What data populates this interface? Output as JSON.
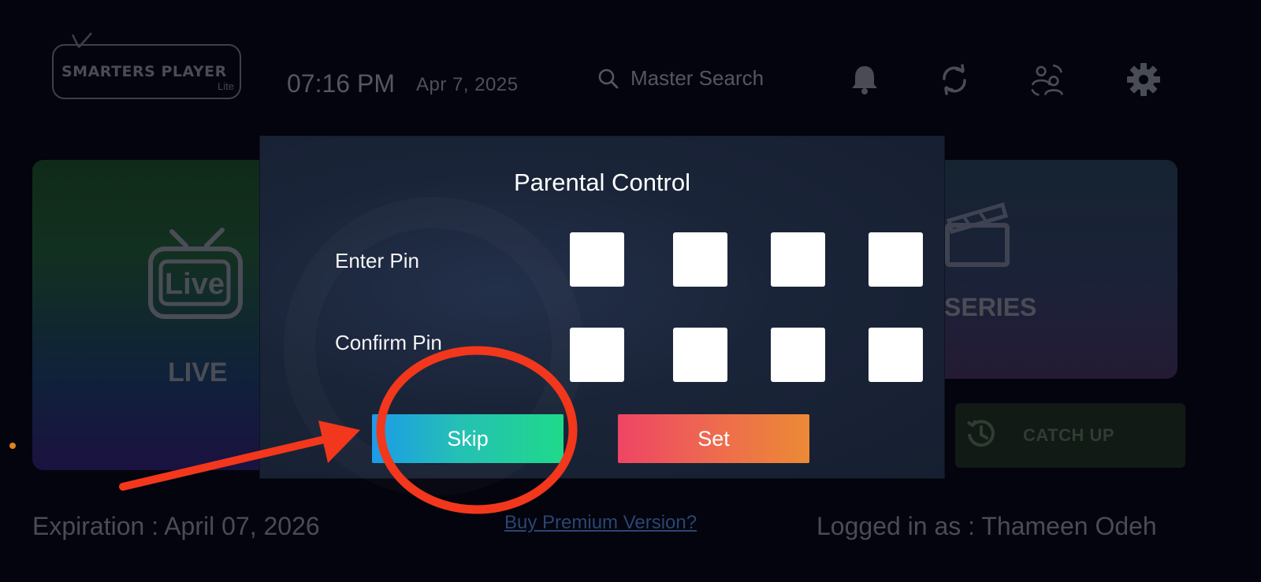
{
  "header": {
    "logo_title": "SMARTERS PLAYER",
    "logo_subtitle": "Lite",
    "time": "07:16 PM",
    "date": "Apr 7, 2025",
    "search_label": "Master Search",
    "icons": [
      "bell-icon",
      "refresh-icon",
      "switch-user-icon",
      "gear-icon"
    ]
  },
  "cards": {
    "live": {
      "title": "LIVE",
      "badge": "Live"
    },
    "series": {
      "title": "SERIES"
    },
    "catch_up": {
      "label": "CATCH UP"
    }
  },
  "dialog": {
    "title": "Parental Control",
    "enter_pin_label": "Enter Pin",
    "confirm_pin_label": "Confirm Pin",
    "skip_label": "Skip",
    "set_label": "Set"
  },
  "footer": {
    "expiration": "Expiration : April 07, 2026",
    "premium_link": "Buy Premium Version?",
    "logged_in": "Logged in as : Thameen Odeh"
  },
  "colors": {
    "background": "#03040d",
    "annotation": "#f2371c",
    "skip_gradient": [
      "#1c9be8",
      "#1fd98a"
    ],
    "set_gradient": [
      "#ee4565",
      "#ec8a35"
    ]
  }
}
